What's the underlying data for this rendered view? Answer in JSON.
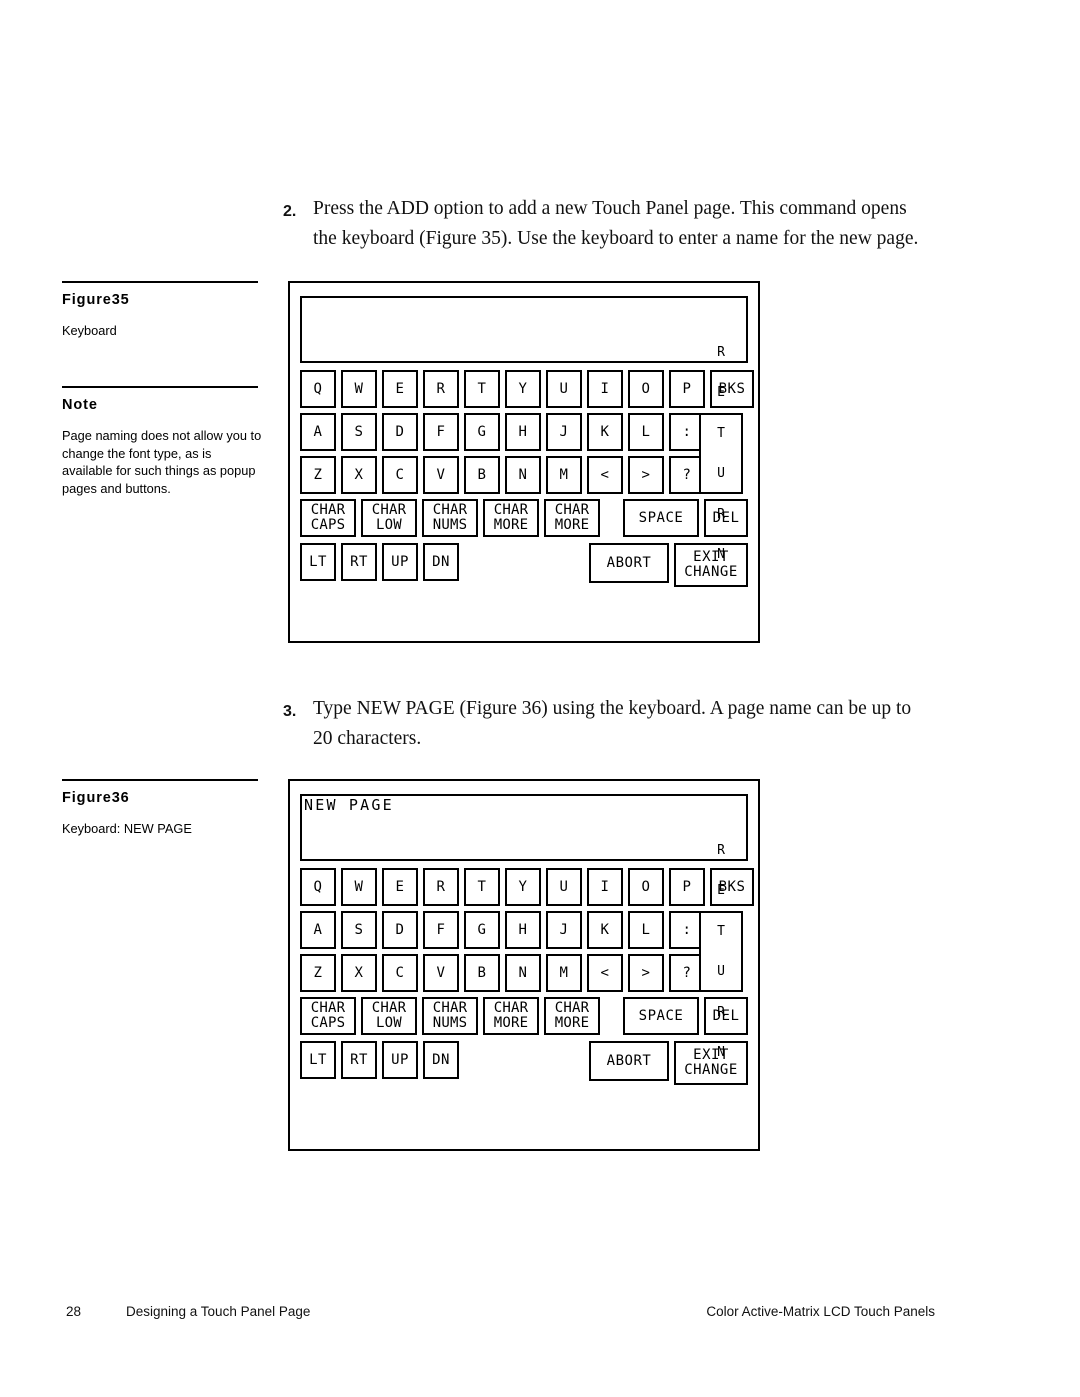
{
  "page": {
    "number": "28",
    "section": "Designing a Touch Panel Page",
    "book": "Color Active-Matrix LCD Touch Panels"
  },
  "steps": [
    {
      "number": "2.",
      "text": "Press the ADD option to add a new Touch Panel page. This command opens the keyboard (Figure 35). Use the keyboard to enter a name for the new page."
    },
    {
      "number": "3.",
      "text": "Type NEW PAGE (Figure 36) using the keyboard. A page name can be up to 20 characters."
    }
  ],
  "margin": {
    "figure35": {
      "title": "Figure35",
      "caption": "Keyboard"
    },
    "note": {
      "title": "Note",
      "text": "Page naming does not allow you to change the font type, as is available for such things as popup pages and buttons."
    },
    "figure36": {
      "title": "Figure36",
      "caption": "Keyboard: NEW PAGE"
    }
  },
  "keyboard": {
    "display_empty": "",
    "display_new_page": "NEW PAGE",
    "row1": [
      "Q",
      "W",
      "E",
      "R",
      "T",
      "Y",
      "U",
      "I",
      "O",
      "P"
    ],
    "row1_end": "BKS",
    "row2": [
      "A",
      "S",
      "D",
      "F",
      "G",
      "H",
      "J",
      "K",
      "L",
      ":"
    ],
    "row3": [
      "Z",
      "X",
      "C",
      "V",
      "B",
      "N",
      "M",
      "<",
      ">",
      "?"
    ],
    "return_label": "RETURN",
    "return_letters": [
      "R",
      "E",
      "T",
      "U",
      "R",
      "N"
    ],
    "char_keys": [
      {
        "top": "CHAR",
        "bottom": "CAPS"
      },
      {
        "top": "CHAR",
        "bottom": "LOW"
      },
      {
        "top": "CHAR",
        "bottom": "NUMS"
      },
      {
        "top": "CHAR",
        "bottom": "MORE"
      },
      {
        "top": "CHAR",
        "bottom": "MORE"
      }
    ],
    "space": "SPACE",
    "del": "DEL",
    "arrows": [
      "LT",
      "RT",
      "UP",
      "DN"
    ],
    "abort": "ABORT",
    "exit_change": {
      "top": "EXIT",
      "bottom": "CHANGE"
    }
  },
  "colors": {
    "ink": "#000000",
    "paper": "#ffffff"
  }
}
